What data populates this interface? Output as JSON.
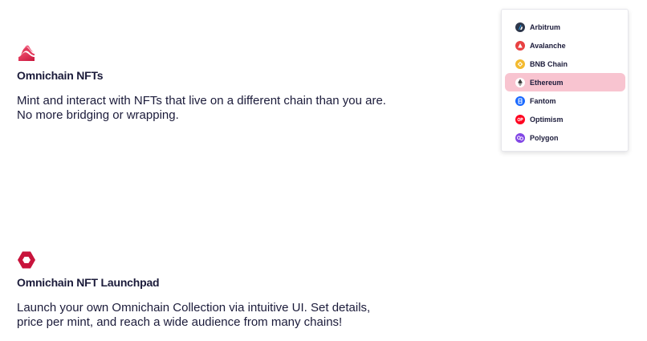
{
  "features": [
    {
      "title": "Omnichain NFTs",
      "description": "Mint and interact with NFTs that live on a different chain than you are.\nNo more bridging or wrapping.",
      "icon": "layered-wave-icon"
    },
    {
      "title": "Omnichain NFT Launchpad",
      "description": "Launch your own Omnichain Collection via intuitive UI. Set details,\nprice per mint, and reach a wide audience from many chains!",
      "icon": "hexagon-icon"
    }
  ],
  "chain_menu": {
    "selected": "Ethereum",
    "items": [
      {
        "label": "Arbitrum",
        "icon": "arbitrum-icon",
        "color": "#2d374b"
      },
      {
        "label": "Avalanche",
        "icon": "avalanche-icon",
        "color": "#e84142"
      },
      {
        "label": "BNB Chain",
        "icon": "bnb-icon",
        "color": "#f3ba2f"
      },
      {
        "label": "Ethereum",
        "icon": "ethereum-icon",
        "color": "#ffffff"
      },
      {
        "label": "Fantom",
        "icon": "fantom-icon",
        "color": "#1969ff"
      },
      {
        "label": "Optimism",
        "icon": "optimism-icon",
        "color": "#ff0420"
      },
      {
        "label": "Polygon",
        "icon": "polygon-icon",
        "color": "#8247e5"
      }
    ]
  },
  "colors": {
    "brand": "#d81e5b",
    "text": "#1b1b3a",
    "selected_bg": "#f8c4d0"
  }
}
